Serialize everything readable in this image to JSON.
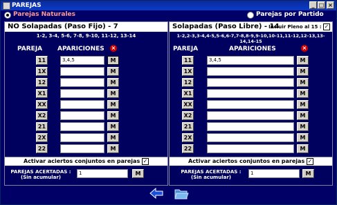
{
  "window": {
    "title": "PAREJAS",
    "min": "_",
    "max": "□",
    "close": "×"
  },
  "modes": {
    "natural_label": "Parejas Naturales",
    "partido_label": "Parejas por Partido"
  },
  "left": {
    "title": "NO Solapadas (Paso Fijo) - 7",
    "combos": "1-2, 3-4, 5-6, 7-8, 9-10, 11-12, 13-14",
    "col_pareja": "PAREJA",
    "col_apariciones": "APARICIONES",
    "rows": [
      {
        "pair": "11",
        "value": "3,4,5",
        "m": "M"
      },
      {
        "pair": "1X",
        "value": "",
        "m": "M"
      },
      {
        "pair": "12",
        "value": "",
        "m": "M"
      },
      {
        "pair": "X1",
        "value": "",
        "m": "M"
      },
      {
        "pair": "XX",
        "value": "",
        "m": "M"
      },
      {
        "pair": "X2",
        "value": "",
        "m": "M"
      },
      {
        "pair": "21",
        "value": "",
        "m": "M"
      },
      {
        "pair": "2X",
        "value": "",
        "m": "M"
      },
      {
        "pair": "22",
        "value": "",
        "m": "M"
      }
    ],
    "activar_label": "Activar aciertos conjuntos en parejas",
    "acertadas_label": "PAREJAS ACERTADAS :",
    "sin_acumular": "(Sin acumular)",
    "acertadas_value": "1",
    "acertadas_m": "M"
  },
  "right": {
    "title": "Solapadas (Paso Libre) - 14",
    "pleno_label": "Incluir Pleno al 15 :",
    "combos": "1-2,2-3,3-4,4-5,5-6,6-7,7-8,8-9,9-10,10-11,11-12,12-13,13-14,14-15",
    "col_pareja": "PAREJA",
    "col_apariciones": "APARICIONES",
    "rows": [
      {
        "pair": "11",
        "value": "3,4,5",
        "m": "M"
      },
      {
        "pair": "1X",
        "value": "",
        "m": "M"
      },
      {
        "pair": "12",
        "value": "",
        "m": "M"
      },
      {
        "pair": "X1",
        "value": "",
        "m": "M"
      },
      {
        "pair": "XX",
        "value": "",
        "m": "M"
      },
      {
        "pair": "X2",
        "value": "",
        "m": "M"
      },
      {
        "pair": "21",
        "value": "",
        "m": "M"
      },
      {
        "pair": "2X",
        "value": "",
        "m": "M"
      },
      {
        "pair": "22",
        "value": "",
        "m": "M"
      }
    ],
    "activar_label": "Activar aciertos conjuntos en parejas",
    "acertadas_label": "PAREJAS ACERTADAS :",
    "sin_acumular": "(Sin acumular)",
    "acertadas_value": "1",
    "acertadas_m": "M"
  },
  "icons": {
    "back": "back-arrow-icon",
    "folder": "open-folder-icon",
    "delete": "delete-x-icon"
  },
  "colors": {
    "natural_label": "#ff9999",
    "partido_label": "#ffffff",
    "panel_bg": "#00005e"
  }
}
